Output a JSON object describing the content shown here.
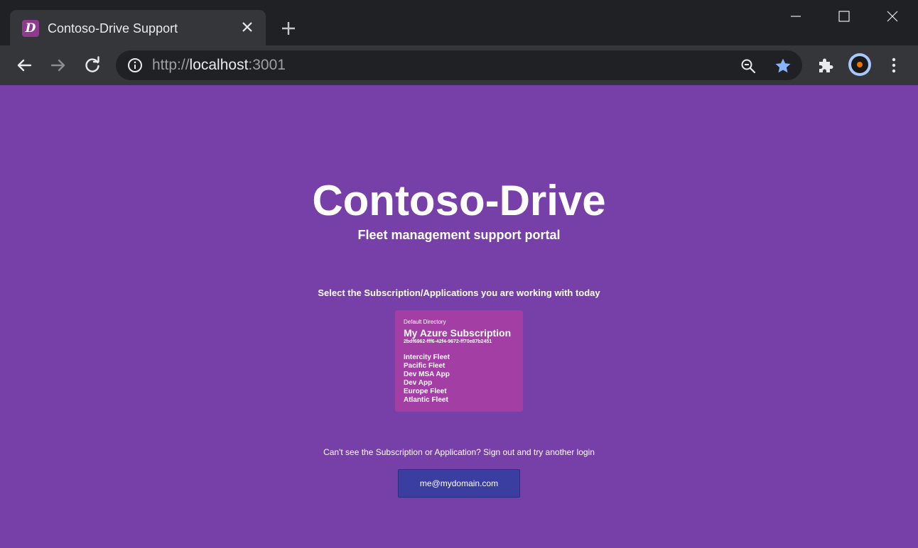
{
  "browser": {
    "tab": {
      "favicon_letter": "D",
      "title": "Contoso-Drive Support",
      "close_glyph": "✕"
    },
    "new_tab_glyph": "+",
    "address_bar": {
      "scheme": "http://",
      "host": "localhost",
      "port": ":3001"
    },
    "icons": [
      "back-arrow-icon",
      "forward-arrow-icon",
      "reload-icon",
      "info-icon",
      "zoom-icon",
      "star-icon",
      "extensions-icon",
      "profile-avatar",
      "kebab-menu-icon",
      "minimize-icon",
      "maximize-icon",
      "window-close-icon"
    ],
    "colors": {
      "star": "#8ab4f8",
      "avatar_ring": "#a8c7fa"
    }
  },
  "page": {
    "background": "#773fa8",
    "title": "Contoso-Drive",
    "subtitle": "Fleet management support portal",
    "select_prompt": "Select the Subscription/Applications you are working with today",
    "subscription_card": {
      "directory": "Default Directory",
      "name": "My Azure Subscription",
      "id": "2bdf6962-fff6-42f4-9672-ff70e87b2451",
      "applications": [
        "Intercity Fleet",
        "Pacific Fleet",
        "Dev MSA App",
        "Dev App",
        "Europe Fleet",
        "Atlantic Fleet"
      ],
      "background": "#a33ea5"
    },
    "signout_message": "Can't see the Subscription or Application? Sign out and try another login",
    "account_button": {
      "label": "me@mydomain.com",
      "background": "#3a3ea1"
    }
  }
}
